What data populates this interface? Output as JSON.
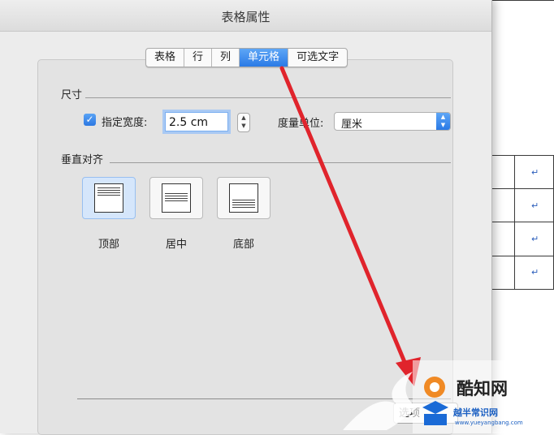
{
  "dialog": {
    "title": "表格属性",
    "tabs": [
      {
        "label": "表格",
        "active": false
      },
      {
        "label": "行",
        "active": false
      },
      {
        "label": "列",
        "active": false
      },
      {
        "label": "单元格",
        "active": true
      },
      {
        "label": "可选文字",
        "active": false
      }
    ],
    "size_section": {
      "label": "尺寸",
      "specify_width_label": "指定宽度:",
      "specify_width_checked": true,
      "width_value": "2.5 cm",
      "unit_label": "度量单位:",
      "unit_value": "厘米"
    },
    "valign_section": {
      "label": "垂直对齐",
      "options": [
        {
          "label": "顶部",
          "selected": true
        },
        {
          "label": "居中",
          "selected": false
        },
        {
          "label": "底部",
          "selected": false
        }
      ]
    },
    "options_button_label": "选项"
  },
  "background_document": {
    "return_mark": "↵"
  },
  "watermark": {
    "brand_top": "酷知网",
    "brand_bottom": "越半常识网",
    "url": "www.yueyangbang.com"
  },
  "colors": {
    "active_tab": "#2a7ae6",
    "arrow": "#e0242c",
    "dialog_bg": "#ececec"
  }
}
